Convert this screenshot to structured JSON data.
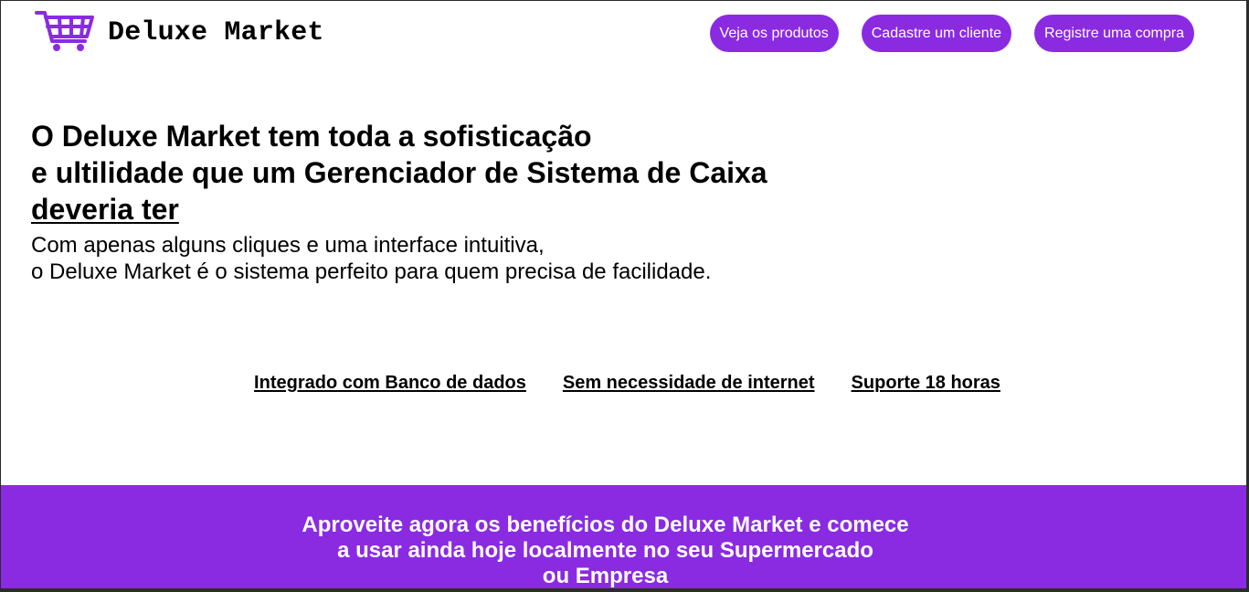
{
  "brand": {
    "name": "Deluxe Market",
    "icon": "shopping-cart-icon",
    "accent_color": "#8a2be2"
  },
  "nav": [
    {
      "label": "Veja os produtos"
    },
    {
      "label": "Cadastre um cliente"
    },
    {
      "label": "Registre uma compra"
    }
  ],
  "hero": {
    "title_line1": "O Deluxe Market tem toda a sofisticação",
    "title_line2": "e ultilidade que um Gerenciador de Sistema de Caixa",
    "title_line3": "deveria ter",
    "subtitle_line1": "Com apenas alguns cliques e uma interface intuitiva,",
    "subtitle_line2": "o Deluxe Market é o sistema perfeito para quem precisa de facilidade."
  },
  "features": [
    {
      "label": "Integrado com Banco de dados"
    },
    {
      "label": "Sem necessidade de internet"
    },
    {
      "label": "Suporte 18 horas"
    }
  ],
  "footer": {
    "line1": "Aproveite agora os benefícios do Deluxe Market e comece",
    "line2": "a usar ainda hoje localmente no seu Supermercado",
    "line3": "ou Empresa"
  }
}
